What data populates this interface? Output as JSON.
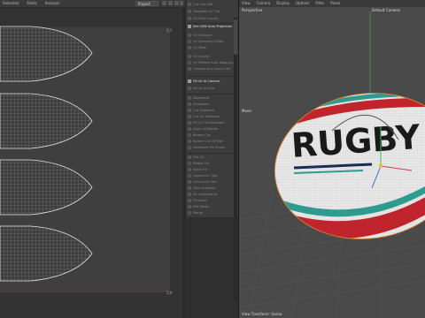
{
  "uv_editor": {
    "menu": [
      "Selection",
      "Fields",
      "Analysis"
    ],
    "dropdown": "Project",
    "tile_label_top": "1,1",
    "tile_label_bottom": "1,0"
  },
  "tool_panel": {
    "items": [
      {
        "label": "Cut UVs Edit",
        "active": false
      },
      {
        "label": "Template UV Tile",
        "active": false
      },
      {
        "label": "UV Shell Layout",
        "active": false
      },
      {
        "label": "Set UVW from Projection",
        "active": true
      },
      {
        "label": "UV Chooser",
        "active": false
      },
      {
        "label": "UV Selection Editor",
        "active": false
      },
      {
        "label": "UV Texel",
        "active": false
      },
      {
        "label": "UV Layout",
        "active": false
      },
      {
        "label": "UV Pattern Area Mapping",
        "active": false
      },
      {
        "label": "Unwrap and Group UVs",
        "active": false
      },
      {
        "label": "Fit UV to Camera",
        "active": true
      },
      {
        "label": "Fit UV to Grid",
        "active": false
      },
      {
        "label": "Alignment",
        "active": false
      },
      {
        "label": "Straighten",
        "active": false
      },
      {
        "label": "Cut Selection",
        "active": false
      },
      {
        "label": "Cut UV Selection",
        "active": false
      },
      {
        "label": "Fit UV Tile Selection",
        "active": false
      },
      {
        "label": "Align UV Border",
        "active": false
      },
      {
        "label": "Border Cut",
        "active": false
      },
      {
        "label": "Border Cut UV Edit",
        "active": false
      },
      {
        "label": "Distribute UV Shells",
        "active": false
      },
      {
        "label": "Flip UV",
        "active": false
      },
      {
        "label": "Rotate UV",
        "active": false
      },
      {
        "label": "Scale UV",
        "active": false
      },
      {
        "label": "Layout UV Tiles",
        "active": false
      },
      {
        "label": "Grid Level UVs",
        "active": false
      },
      {
        "label": "Split Selected",
        "active": false
      },
      {
        "label": "Fix Consistency",
        "active": false
      },
      {
        "label": "Preserve",
        "active": false
      },
      {
        "label": "Pelt Mode",
        "active": false
      },
      {
        "label": "Morph",
        "active": false
      }
    ]
  },
  "viewport": {
    "menu": [
      "View",
      "Camera",
      "Display",
      "Options",
      "Filter",
      "Panel"
    ],
    "perspective_label": "Perspective",
    "camera_label": "Default Camera",
    "move_label": "Move",
    "status": "View Transform: Scene",
    "ball_text": "RUGBY",
    "colors": {
      "stripe_red": "#c0242c",
      "stripe_teal": "#2f9a8e",
      "stripe_navy": "#1a2e55",
      "ball_white": "#e8e8e8",
      "text_dark": "#1a1a1a",
      "outline_orange": "#d9822b"
    }
  }
}
